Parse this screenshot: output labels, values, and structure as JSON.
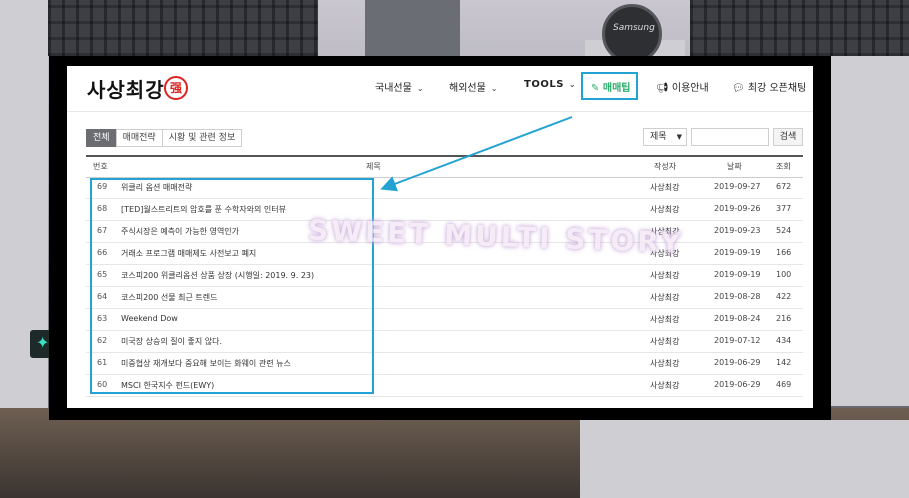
{
  "header": {
    "logo_text": "사상최강",
    "logo_seal": "强",
    "nav": [
      {
        "label": "국내선물",
        "has_dropdown": true
      },
      {
        "label": "해외선물",
        "has_dropdown": true
      },
      {
        "label": "TOOLS",
        "has_dropdown": true
      },
      {
        "label": "매매팁",
        "icon": "edit-icon",
        "highlighted": true
      },
      {
        "label": "이용안내",
        "icon": "megaphone-icon"
      },
      {
        "label": "최강 오픈채팅",
        "icon": "chat-icon"
      }
    ]
  },
  "tabs": [
    {
      "label": "전체",
      "active": true
    },
    {
      "label": "매매전략",
      "active": false
    },
    {
      "label": "시황 및 관련 정보",
      "active": false
    }
  ],
  "search": {
    "field_selected": "제목",
    "input_value": "",
    "button_label": "검색"
  },
  "table": {
    "headers": {
      "num": "번호",
      "title": "제목",
      "author": "작성자",
      "date": "날짜",
      "views": "조회"
    },
    "rows": [
      {
        "num": "69",
        "title": "위클리 옵션 매매전략",
        "author": "사상최강",
        "date": "2019-09-27",
        "views": "672"
      },
      {
        "num": "68",
        "title": "[TED]월스트리트의 암호를 푼 수학자와의 인터뷰",
        "author": "사상최강",
        "date": "2019-09-26",
        "views": "377"
      },
      {
        "num": "67",
        "title": "주식시장은 예측이 가능한 영역인가",
        "author": "사상최강",
        "date": "2019-09-23",
        "views": "524"
      },
      {
        "num": "66",
        "title": "거래소 프로그램 매매제도 사전보고 폐지",
        "author": "사상최강",
        "date": "2019-09-19",
        "views": "166"
      },
      {
        "num": "65",
        "title": "코스피200 위클리옵션 상품 상장 (시행일: 2019. 9. 23)",
        "author": "사상최강",
        "date": "2019-09-19",
        "views": "100"
      },
      {
        "num": "64",
        "title": "코스피200 선물 최근 트렌드",
        "author": "사상최강",
        "date": "2019-08-28",
        "views": "422"
      },
      {
        "num": "63",
        "title": "Weekend Dow",
        "author": "사상최강",
        "date": "2019-08-24",
        "views": "216"
      },
      {
        "num": "62",
        "title": "미국장 상승의 질이 좋지 않다.",
        "author": "사상최강",
        "date": "2019-07-12",
        "views": "434"
      },
      {
        "num": "61",
        "title": "미중협상 재개보다 중요해 보이는 화웨이 관련 뉴스",
        "author": "사상최강",
        "date": "2019-06-29",
        "views": "142"
      },
      {
        "num": "60",
        "title": "MSCI 한국지수 펀드(EWY)",
        "author": "사상최강",
        "date": "2019-06-29",
        "views": "469"
      }
    ]
  },
  "watermark": "SWEET MULTI STORY",
  "colors": {
    "highlight": "#23a3d4",
    "logo_red": "#dd2222",
    "active_tab": "#6b6d72",
    "nav_highlight_text": "#2dad6b"
  }
}
